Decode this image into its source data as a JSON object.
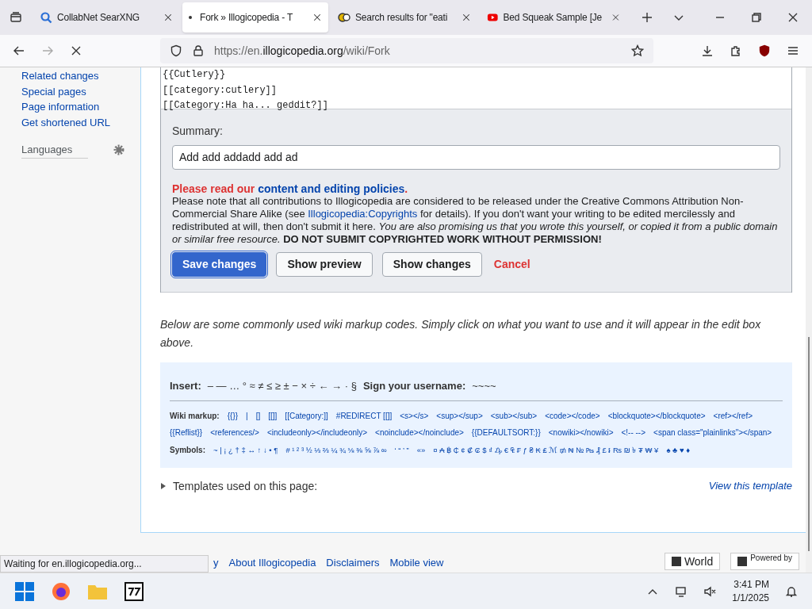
{
  "tabs": [
    {
      "title": "CollabNet SearXNG",
      "kind": "search",
      "selected": false
    },
    {
      "title": "Fork » Illogicopedia - T",
      "kind": "loading",
      "selected": true
    },
    {
      "title": "Search results for \"eati",
      "kind": "site",
      "selected": false
    },
    {
      "title": "Bed Squeak Sample [Je",
      "kind": "video",
      "selected": false
    }
  ],
  "address": {
    "prefix": "https://en.",
    "domain": "illogicopedia.org",
    "path": "/wiki/Fork"
  },
  "sidebar": {
    "links": [
      "Related changes",
      "Special pages",
      "Page information",
      "Get shortened URL"
    ],
    "languages": "Languages"
  },
  "editor": {
    "lines": [
      "{{Cutlery}}",
      "[[category:cutlery]]",
      "[[Category:Ha ha... geddit?]]"
    ]
  },
  "summary": {
    "label": "Summary:",
    "value": "Add add addadd add ad"
  },
  "policy": {
    "lead": "Please read our",
    "link": "content and editing policies",
    "end": "."
  },
  "notice": {
    "before": "Please note that all contributions to Illogicopedia are considered to be released under the Creative Commons Attribution Non-Commercial Share Alike (see",
    "link": "Illogicopedia:Copyrights",
    "after": "for details). If you don't want your writing to be edited mercilessly and redistributed at will, then don't submit it here. *You are also promising us that you wrote this yourself, or copied it from a public domain or similar free resource.* **DO NOT SUBMIT COPYRIGHTED WORK WITHOUT PERMISSION!**"
  },
  "buttons": [
    {
      "label": "Save changes",
      "kind": "primary"
    },
    {
      "label": "Show preview",
      "kind": "normal"
    },
    {
      "label": "Show changes",
      "kind": "normal"
    },
    {
      "label": "Cancel",
      "kind": "cancel"
    }
  ],
  "help_text": "Below are some commonly used wiki markup codes. Simply click on what you want to use and it will appear in the edit box above.",
  "insert": {
    "label": "Insert:",
    "chars": "– — … ° ≈ ≠ ≤ ≥ ± − × ÷ ← → · §",
    "sign_label": "Sign your username:",
    "sign": "~~~~"
  },
  "markup": {
    "label": "Wiki markup:",
    "items": [
      "{{}}",
      "|",
      "[]",
      "[[]]",
      "[[Category:]]",
      "#REDIRECT [[]]",
      "<s></s>",
      "<sup></sup>",
      "<sub></sub>",
      "<code></code>",
      "<blockquote></blockquote>",
      "<ref></ref>",
      "{{Reflist}}",
      "<references/>",
      "<includeonly></includeonly>",
      "<noinclude></noinclude>",
      "{{DEFAULTSORT:}}",
      "<nowiki></nowiki>",
      "<!-- -->",
      "<span class=\"plainlinks\"></span>"
    ]
  },
  "symbols": {
    "label": "Symbols:",
    "groups": [
      "~ | ¡ ¿ † ‡ ↔ ↑ ↓ • ¶",
      "# ¹ ² ³ ½ ⅓ ⅔ ¼ ¾ ⅛ ⅜ ⅝ ⅞ ∞",
      "‘ “ ’ ”",
      "«»",
      "¤ ₳ ฿ ₵ ¢ ₡ ₢ $ ₫ ₯ € ₠ ₣ ƒ ₴ ₭ ₤ ℳ ₥ ₦ № ₧ ₰ £ ៛ ₨ ₪ ৳ ₮ ₩ ¥",
      "♠ ♣ ♥ ♦"
    ]
  },
  "templates": {
    "label": "Templates used on this page:",
    "expanded": false,
    "link": "View this template"
  },
  "footer": {
    "links": [
      "y",
      "About Illogicopedia",
      "Disclaimers",
      "Mobile view"
    ],
    "badges": [
      "World",
      "Powered by"
    ]
  },
  "status": "Waiting for en.illogicopedia.org...",
  "clock": {
    "time": "3:41 PM",
    "date": "1/1/2025"
  }
}
